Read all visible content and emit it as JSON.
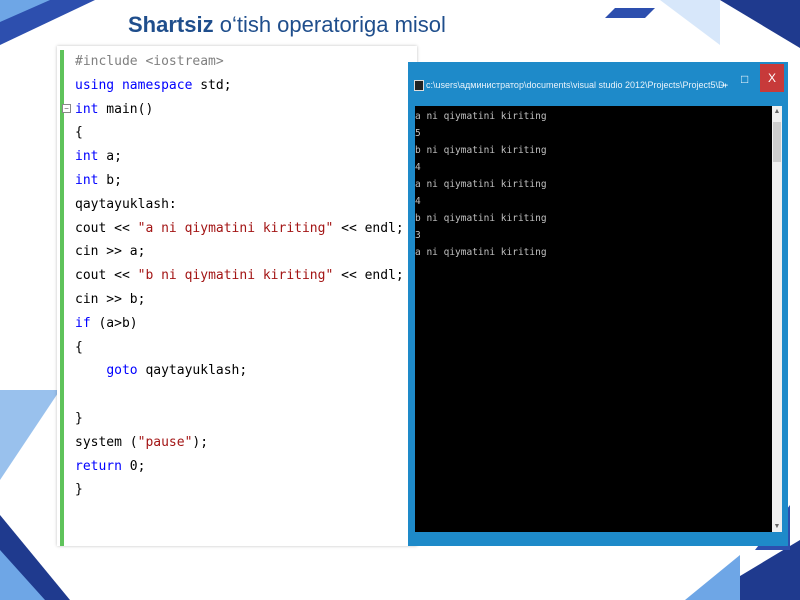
{
  "slide": {
    "title_bold": "Shartsiz",
    "title_rest": " o‘tish operatoriga misol"
  },
  "editor": {
    "lines": [
      {
        "type": "pp",
        "text": "#include <iostream>"
      },
      {
        "type": "mix",
        "parts": [
          {
            "c": "kw",
            "t": "using namespace"
          },
          {
            "c": "",
            "t": " std;"
          }
        ]
      },
      {
        "type": "mix",
        "parts": [
          {
            "c": "kw",
            "t": "int"
          },
          {
            "c": "",
            "t": " main()"
          }
        ]
      },
      {
        "type": "plain",
        "text": "{"
      },
      {
        "type": "mix",
        "parts": [
          {
            "c": "kw",
            "t": "int"
          },
          {
            "c": "",
            "t": " a;"
          }
        ]
      },
      {
        "type": "mix",
        "parts": [
          {
            "c": "kw",
            "t": "int"
          },
          {
            "c": "",
            "t": " b;"
          }
        ]
      },
      {
        "type": "plain",
        "text": "qaytayuklash:"
      },
      {
        "type": "mix",
        "parts": [
          {
            "c": "",
            "t": "cout << "
          },
          {
            "c": "st",
            "t": "\"a ni qiymatini kiriting\""
          },
          {
            "c": "",
            "t": " << endl;"
          }
        ]
      },
      {
        "type": "plain",
        "text": "cin >> a;"
      },
      {
        "type": "mix",
        "parts": [
          {
            "c": "",
            "t": "cout << "
          },
          {
            "c": "st",
            "t": "\"b ni qiymatini kiriting\""
          },
          {
            "c": "",
            "t": " << endl;"
          }
        ]
      },
      {
        "type": "plain",
        "text": "cin >> b;"
      },
      {
        "type": "mix",
        "parts": [
          {
            "c": "kw",
            "t": "if"
          },
          {
            "c": "",
            "t": " (a>b)"
          }
        ]
      },
      {
        "type": "plain",
        "text": "{"
      },
      {
        "type": "mix",
        "parts": [
          {
            "c": "",
            "t": "    "
          },
          {
            "c": "kw",
            "t": "goto"
          },
          {
            "c": "",
            "t": " qaytayuklash;"
          }
        ]
      },
      {
        "type": "plain",
        "text": ""
      },
      {
        "type": "plain",
        "text": "}"
      },
      {
        "type": "mix",
        "parts": [
          {
            "c": "",
            "t": "system ("
          },
          {
            "c": "st",
            "t": "\"pause\""
          },
          {
            "c": "",
            "t": ");"
          }
        ]
      },
      {
        "type": "mix",
        "parts": [
          {
            "c": "kw",
            "t": "return"
          },
          {
            "c": "",
            "t": " 0;"
          }
        ]
      },
      {
        "type": "plain",
        "text": "}"
      }
    ]
  },
  "console": {
    "title_path": "c:\\users\\администратор\\documents\\visual studio 2012\\Projects\\Project5\\Debu...",
    "close_label": "X",
    "minimize_label": "_",
    "maximize_label": "□",
    "output": "a ni qiymatini kiriting\n5\nb ni qiymatini kiriting\n4\na ni qiymatini kiriting\n4\nb ni qiymatini kiriting\n3\na ni qiymatini kiriting"
  }
}
